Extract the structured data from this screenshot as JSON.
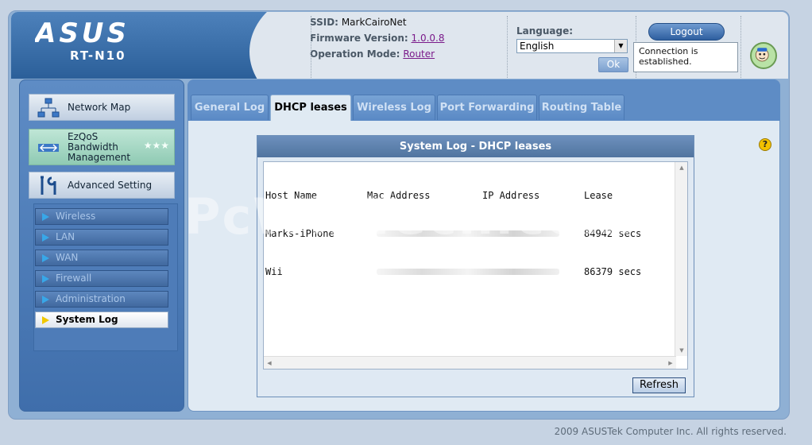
{
  "header": {
    "logo_text": "ASUS",
    "model": "RT-N10",
    "ssid_label": "SSID:",
    "ssid_value": "MarkCairoNet",
    "firmware_label": "Firmware Version:",
    "firmware_value": "1.0.0.8",
    "mode_label": "Operation Mode:",
    "mode_value": "Router",
    "language_label": "Language:",
    "language_value": "English",
    "ok_label": "Ok",
    "logout_label": "Logout",
    "connection_line1": "Connection is",
    "connection_line2": "established."
  },
  "sidebar": {
    "main_items": [
      {
        "label": "Network Map"
      },
      {
        "label_lines": [
          "EzQoS",
          "Bandwidth",
          "Management"
        ]
      },
      {
        "label": "Advanced Setting"
      }
    ],
    "sub_items": [
      {
        "label": "Wireless",
        "active": false
      },
      {
        "label": "LAN",
        "active": false
      },
      {
        "label": "WAN",
        "active": false
      },
      {
        "label": "Firewall",
        "active": false
      },
      {
        "label": "Administration",
        "active": false
      },
      {
        "label": "System Log",
        "active": true
      }
    ]
  },
  "tabs": [
    {
      "label": "General Log",
      "active": false
    },
    {
      "label": "DHCP leases",
      "active": true
    },
    {
      "label": "Wireless Log",
      "active": false
    },
    {
      "label": "Port Forwarding",
      "active": false
    },
    {
      "label": "Routing Table",
      "active": false
    }
  ],
  "log": {
    "title": "System Log - DHCP leases",
    "columns": [
      "Host Name",
      "Mac Address",
      "IP Address",
      "Lease"
    ],
    "rows": [
      {
        "host": "Marks-iPhone",
        "mac": "",
        "ip": "",
        "lease": "84942 secs"
      },
      {
        "host": "Wii",
        "mac": "",
        "ip": "",
        "lease": "86379 secs"
      }
    ],
    "refresh_label": "Refresh"
  },
  "help_icon": "?",
  "watermark": "PcWinTech.com",
  "footer": "2009 ASUSTek Computer Inc. All rights reserved.",
  "colors": {
    "brand_blue": "#3f6eab",
    "tab_active_bg": "#e0eaf3",
    "active_marker": "#f0c800"
  }
}
